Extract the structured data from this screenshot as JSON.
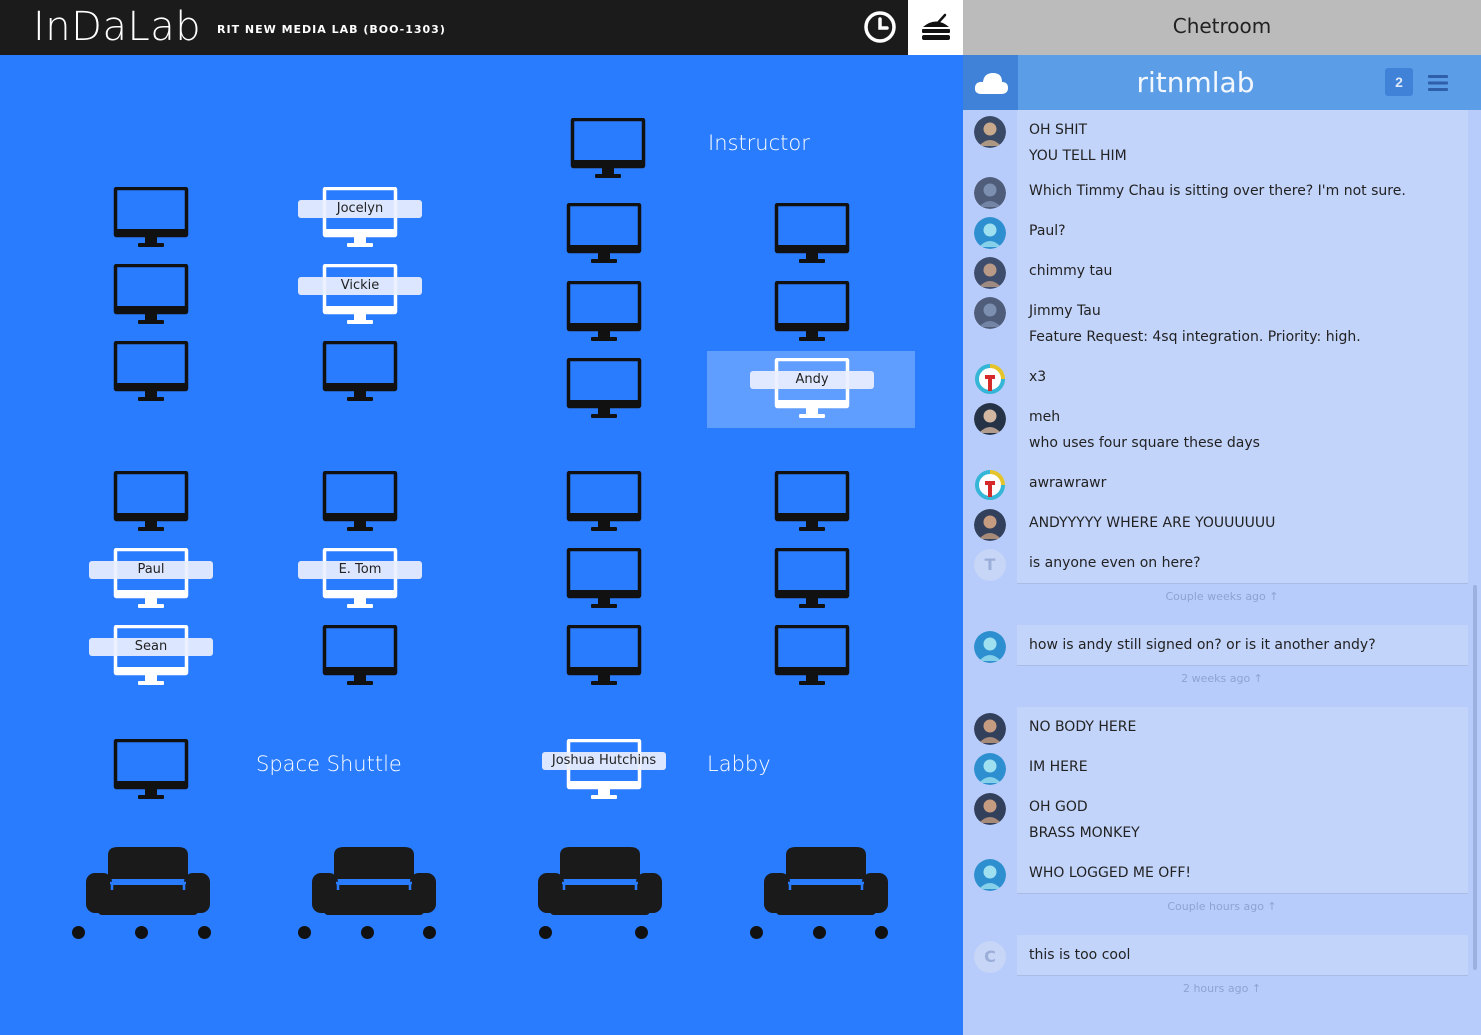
{
  "header": {
    "logo": "InDaLab",
    "subtitle": "RIT NEW MEDIA LAB (BOO-1303)",
    "icons": [
      "clock-icon",
      "food-icon"
    ]
  },
  "floor": {
    "stations": [
      "Jocelyn",
      "Vickie",
      "Andy",
      "Paul",
      "E. Tom",
      "Sean",
      "Joshua Hutchins"
    ],
    "rooms": [
      "Instructor",
      "Space Shuttle",
      "Labby"
    ],
    "couches": 4
  },
  "chat": {
    "title": "Chetroom",
    "room": "ritnmlab",
    "user_count": "2",
    "icons": [
      "cloud-icon",
      "menu-icon"
    ],
    "messages": [
      {
        "lines": [
          "OH SHIT",
          "YOU TELL HIM"
        ]
      },
      {
        "lines": [
          "Which Timmy Chau is sitting over there? I'm not sure."
        ]
      },
      {
        "lines": [
          "Paul?"
        ]
      },
      {
        "lines": [
          "chimmy tau"
        ]
      },
      {
        "lines": [
          "Jimmy Tau",
          "Feature Request: 4sq integration. Priority: high."
        ]
      },
      {
        "lines": [
          "x3"
        ]
      },
      {
        "lines": [
          "meh",
          "who uses four square these days"
        ]
      },
      {
        "lines": [
          "awrawrawr"
        ]
      },
      {
        "lines": [
          "ANDYYYYY WHERE ARE YOUUUUUU"
        ]
      },
      {
        "lines": [
          "is anyone even on here?"
        ],
        "initial": "T"
      },
      {
        "lines": [
          "how is andy still signed on? or is it another andy?"
        ]
      },
      {
        "lines": [
          "NO BODY HERE"
        ]
      },
      {
        "lines": [
          "IM HERE"
        ]
      },
      {
        "lines": [
          "OH GOD",
          "BRASS MONKEY"
        ]
      },
      {
        "lines": [
          "WHO LOGGED ME OFF!"
        ]
      },
      {
        "lines": [
          "this is too cool"
        ],
        "initial": "C"
      }
    ],
    "timestamps": [
      "Couple weeks ago ↑",
      "2 weeks ago ↑",
      "Couple hours ago ↑",
      "2 hours ago ↑"
    ]
  },
  "colors": {
    "floor": "#2a7cff",
    "topbar": "#1b1b1b",
    "chat_bg": "#b7ccfa",
    "chat_header": "#5b9de6",
    "monitor_off": "#111111",
    "monitor_on": "#ffffff"
  }
}
